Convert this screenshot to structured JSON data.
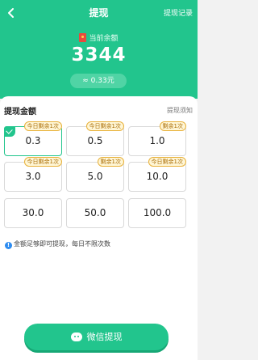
{
  "header": {
    "title": "提现",
    "record_link": "提现记录",
    "balance_label": "当前余额",
    "balance": "3344",
    "balance_yuan": "≈ 0.33元"
  },
  "panel": {
    "title": "提现金额",
    "notice_link": "提现须知",
    "options": [
      {
        "value": "0.3",
        "tag": "今日剩余1次",
        "selected": true
      },
      {
        "value": "0.5",
        "tag": "今日剩余1次"
      },
      {
        "value": "1.0",
        "tag": "剩余1次"
      },
      {
        "value": "3.0",
        "tag": "今日剩余1次"
      },
      {
        "value": "5.0",
        "tag": "剩余1次"
      },
      {
        "value": "10.0",
        "tag": "今日剩余1次"
      },
      {
        "value": "30.0",
        "tag": ""
      },
      {
        "value": "50.0",
        "tag": ""
      },
      {
        "value": "100.0",
        "tag": ""
      }
    ],
    "tip": "金额足够即可提现，每日不限次数"
  },
  "button": {
    "label": "微信提现"
  },
  "colors": {
    "accent": "#22c58d",
    "tag_border": "#e8b13a"
  }
}
